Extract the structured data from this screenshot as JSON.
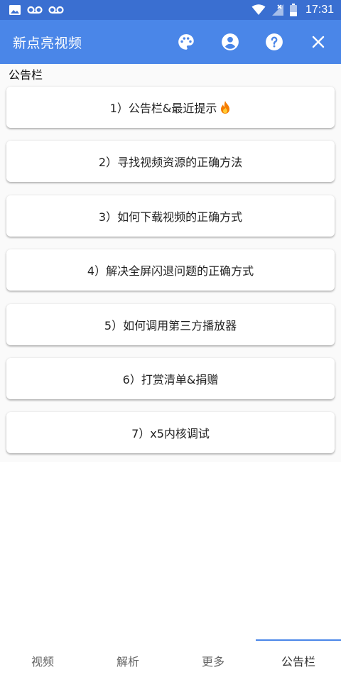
{
  "status_bar": {
    "time": "17:31",
    "icons": [
      "image-icon",
      "voicemail-icon",
      "voicemail-icon",
      "wifi-icon",
      "signal-off-icon",
      "battery-icon"
    ]
  },
  "app_bar": {
    "title": "新点亮视频",
    "actions": [
      "palette-icon",
      "account-icon",
      "help-icon",
      "close-icon"
    ],
    "color": "#4a86e8"
  },
  "section": {
    "title": "公告栏"
  },
  "items": [
    {
      "label": "1）公告栏&最近提示",
      "icon": "fire-icon"
    },
    {
      "label": "2）寻找视频资源的正确方法"
    },
    {
      "label": "3）如何下载视频的正确方式"
    },
    {
      "label": "4）解决全屏闪退问题的正确方式"
    },
    {
      "label": "5）如何调用第三方播放器"
    },
    {
      "label": "6）打赏清单&捐赠"
    },
    {
      "label": "7）x5内核调试"
    }
  ],
  "bottom_nav": {
    "tabs": [
      {
        "label": "视频"
      },
      {
        "label": "解析"
      },
      {
        "label": "更多"
      },
      {
        "label": "公告栏"
      }
    ],
    "active": "公告栏"
  }
}
